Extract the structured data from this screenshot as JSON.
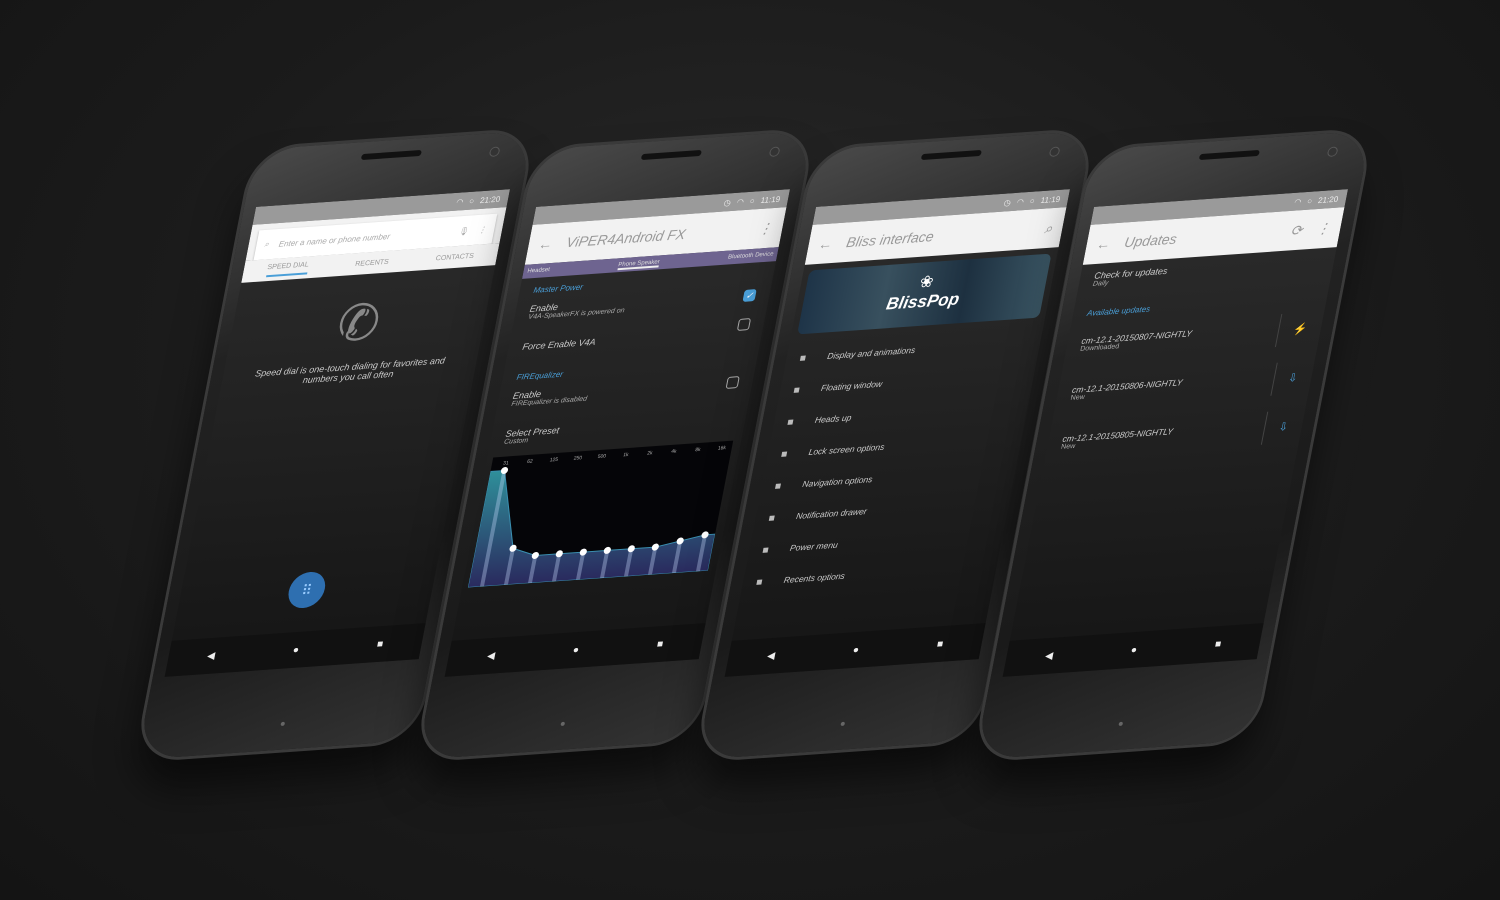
{
  "phone1": {
    "status_time": "21:20",
    "search_placeholder": "Enter a name or phone number",
    "tabs": [
      "SPEED DIAL",
      "RECENTS",
      "CONTACTS"
    ],
    "empty_text": "Speed dial is one-touch dialing for favorites and numbers you call often",
    "fab_icon": "dialpad-icon"
  },
  "phone2": {
    "status_time": "11:19",
    "title": "ViPER4Android FX",
    "tabs": [
      "Headset",
      "Phone Speaker",
      "Bluetooth Device"
    ],
    "sections": {
      "master": "Master Power",
      "fir": "FIREqualizer"
    },
    "enable": {
      "label": "Enable",
      "sub": "V4A-SpeakerFX is powered on",
      "checked": true
    },
    "force": {
      "label": "Force Enable V4A",
      "checked": false
    },
    "fir_enable": {
      "label": "Enable",
      "sub": "FIREqualizer is disabled",
      "checked": false
    },
    "preset": {
      "label": "Select Preset",
      "value": "Custom"
    },
    "eq": {
      "bands": [
        "31",
        "62",
        "125",
        "250",
        "500",
        "1k",
        "2k",
        "4k",
        "8k",
        "16k"
      ],
      "levels": [
        10,
        1,
        0,
        0,
        0,
        0,
        0,
        0,
        0.5,
        1
      ],
      "accent": "#3a8fb0"
    }
  },
  "phone3": {
    "status_time": "11:19",
    "title": "Bliss interface",
    "banner": "BlissPop",
    "items": [
      "Display and animations",
      "Floating window",
      "Heads up",
      "Lock screen options",
      "Navigation options",
      "Notification drawer",
      "Power menu",
      "Recents options"
    ]
  },
  "phone4": {
    "status_time": "21:20",
    "title": "Updates",
    "check": {
      "label": "Check for updates",
      "value": "Daily"
    },
    "section": "Available updates",
    "updates": [
      {
        "name": "cm-12.1-20150807-NIGHTLY",
        "status": "Downloaded",
        "icon": "flash-icon"
      },
      {
        "name": "cm-12.1-20150806-NIGHTLY",
        "status": "New",
        "icon": "download-icon"
      },
      {
        "name": "cm-12.1-20150805-NIGHTLY",
        "status": "New",
        "icon": "download-icon"
      }
    ]
  },
  "colors": {
    "accent": "#4a9fd8",
    "viper_tabs": "#6e6490",
    "background": "#1b1b1b"
  }
}
